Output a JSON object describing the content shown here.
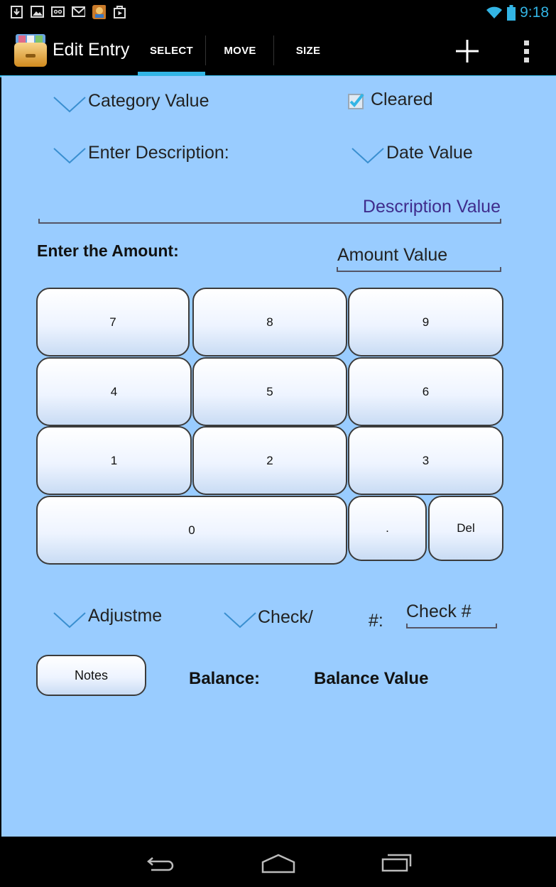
{
  "status_bar": {
    "time": "9:18",
    "left_icons": [
      "download-icon",
      "image-icon",
      "voicemail-icon",
      "gmail-icon",
      "game-app-icon",
      "play-store-icon"
    ],
    "right_icons": [
      "wifi-icon",
      "battery-icon"
    ]
  },
  "action_bar": {
    "title": "Edit Entry",
    "tabs": [
      {
        "label": "SELECT",
        "selected": true
      },
      {
        "label": "MOVE",
        "selected": false
      },
      {
        "label": "SIZE",
        "selected": false
      }
    ],
    "accent": "#33b5e5"
  },
  "form": {
    "category_value": "Category Value",
    "cleared_label": "Cleared",
    "cleared_checked": true,
    "description_prompt": "Enter Description:",
    "date_value": "Date Value",
    "description_value": "Description Value",
    "amount_label": "Enter the Amount:",
    "amount_value": "Amount Value",
    "adjustment_value": "Adjustme",
    "check_label": "Check/",
    "check_number_prefix": "#:",
    "check_number_value": "Check #",
    "notes_button": "Notes",
    "balance_label": "Balance:",
    "balance_value": "Balance Value",
    "background": "#99ccff"
  },
  "keypad": {
    "row1": [
      "7",
      "8",
      "9"
    ],
    "row2": [
      "4",
      "5",
      "6"
    ],
    "row3": [
      "1",
      "2",
      "3"
    ],
    "row4": [
      "0",
      ".",
      "Del"
    ]
  },
  "nav_bar": {
    "buttons": [
      "back-icon",
      "home-icon",
      "recent-apps-icon"
    ]
  }
}
